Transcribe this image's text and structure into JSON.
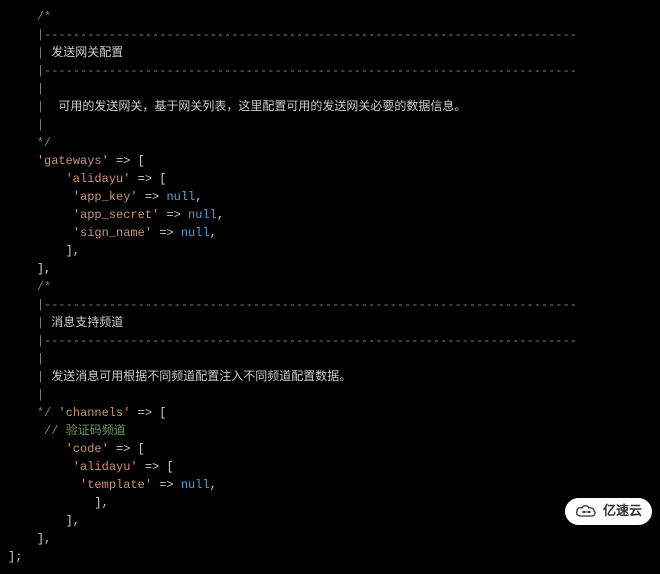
{
  "code": {
    "lines": [
      {
        "indent": "    ",
        "parts": [
          {
            "cls": "comment",
            "text": "/*"
          }
        ]
      },
      {
        "indent": "    ",
        "parts": [
          {
            "cls": "comment",
            "text": "|--------------------------------------------------------------------------"
          }
        ]
      },
      {
        "indent": "    ",
        "parts": [
          {
            "cls": "comment",
            "text": "| "
          },
          {
            "cls": "comment-cn",
            "text": "发送网关配置"
          }
        ]
      },
      {
        "indent": "    ",
        "parts": [
          {
            "cls": "comment",
            "text": "|--------------------------------------------------------------------------"
          }
        ]
      },
      {
        "indent": "    ",
        "parts": [
          {
            "cls": "comment",
            "text": "|"
          }
        ]
      },
      {
        "indent": "    ",
        "parts": [
          {
            "cls": "comment",
            "text": "| "
          },
          {
            "cls": "comment-cn",
            "text": " 可用的发送网关，基于网关列表，这里配置可用的发送网关必要的数据信息。"
          }
        ]
      },
      {
        "indent": "    ",
        "parts": [
          {
            "cls": "comment",
            "text": "|"
          }
        ]
      },
      {
        "indent": "    ",
        "parts": [
          {
            "cls": "comment",
            "text": "*/"
          }
        ]
      },
      {
        "indent": "    ",
        "parts": [
          {
            "cls": "string",
            "text": "'gateways'"
          },
          {
            "cls": "arrow",
            "text": " => "
          },
          {
            "cls": "bracket",
            "text": "["
          }
        ]
      },
      {
        "indent": "        ",
        "parts": [
          {
            "cls": "string",
            "text": "'alidayu'"
          },
          {
            "cls": "arrow",
            "text": " => "
          },
          {
            "cls": "bracket",
            "text": "["
          }
        ]
      },
      {
        "indent": "         ",
        "parts": [
          {
            "cls": "string",
            "text": "'app_key'"
          },
          {
            "cls": "arrow",
            "text": " => "
          },
          {
            "cls": "keyword-null",
            "text": "null"
          },
          {
            "cls": "comma",
            "text": ","
          }
        ]
      },
      {
        "indent": "         ",
        "parts": [
          {
            "cls": "string",
            "text": "'app_secret'"
          },
          {
            "cls": "arrow",
            "text": " => "
          },
          {
            "cls": "keyword-null",
            "text": "null"
          },
          {
            "cls": "comma",
            "text": ","
          }
        ]
      },
      {
        "indent": "         ",
        "parts": [
          {
            "cls": "string",
            "text": "'sign_name'"
          },
          {
            "cls": "arrow",
            "text": " => "
          },
          {
            "cls": "keyword-null",
            "text": "null"
          },
          {
            "cls": "comma",
            "text": ","
          }
        ]
      },
      {
        "indent": "        ",
        "parts": [
          {
            "cls": "bracket",
            "text": "],"
          }
        ]
      },
      {
        "indent": "    ",
        "parts": [
          {
            "cls": "bracket",
            "text": "],"
          }
        ]
      },
      {
        "indent": "    ",
        "parts": [
          {
            "cls": "comment",
            "text": "/*"
          }
        ]
      },
      {
        "indent": "    ",
        "parts": [
          {
            "cls": "comment",
            "text": "|--------------------------------------------------------------------------"
          }
        ]
      },
      {
        "indent": "    ",
        "parts": [
          {
            "cls": "comment",
            "text": "| "
          },
          {
            "cls": "comment-cn",
            "text": "消息支持频道"
          }
        ]
      },
      {
        "indent": "    ",
        "parts": [
          {
            "cls": "comment",
            "text": "|--------------------------------------------------------------------------"
          }
        ]
      },
      {
        "indent": "    ",
        "parts": [
          {
            "cls": "comment",
            "text": "|"
          }
        ]
      },
      {
        "indent": "    ",
        "parts": [
          {
            "cls": "comment",
            "text": "| "
          },
          {
            "cls": "comment-cn",
            "text": "发送消息可用根据不同频道配置注入不同频道配置数据。"
          }
        ]
      },
      {
        "indent": "    ",
        "parts": [
          {
            "cls": "comment",
            "text": "|"
          }
        ]
      },
      {
        "indent": "    ",
        "parts": [
          {
            "cls": "comment",
            "text": "*/ "
          },
          {
            "cls": "string",
            "text": "'channels'"
          },
          {
            "cls": "arrow",
            "text": " => "
          },
          {
            "cls": "bracket",
            "text": "["
          }
        ]
      },
      {
        "indent": "     ",
        "parts": [
          {
            "cls": "line-comment",
            "text": "// 验证码频道"
          }
        ]
      },
      {
        "indent": "        ",
        "parts": [
          {
            "cls": "string",
            "text": "'code'"
          },
          {
            "cls": "arrow",
            "text": " => "
          },
          {
            "cls": "bracket",
            "text": "["
          }
        ]
      },
      {
        "indent": "         ",
        "parts": [
          {
            "cls": "string",
            "text": "'alidayu'"
          },
          {
            "cls": "arrow",
            "text": " => "
          },
          {
            "cls": "bracket",
            "text": "["
          }
        ]
      },
      {
        "indent": "          ",
        "parts": [
          {
            "cls": "string",
            "text": "'template'"
          },
          {
            "cls": "arrow",
            "text": " => "
          },
          {
            "cls": "keyword-null",
            "text": "null"
          },
          {
            "cls": "comma",
            "text": ","
          }
        ]
      },
      {
        "indent": "            ",
        "parts": [
          {
            "cls": "bracket",
            "text": "],"
          }
        ]
      },
      {
        "indent": "        ",
        "parts": [
          {
            "cls": "bracket",
            "text": "],"
          }
        ]
      },
      {
        "indent": "    ",
        "parts": [
          {
            "cls": "bracket",
            "text": "],"
          }
        ]
      },
      {
        "indent": "",
        "parts": [
          {
            "cls": "bracket",
            "text": "];"
          }
        ]
      }
    ]
  },
  "watermark": {
    "text": "亿速云"
  }
}
